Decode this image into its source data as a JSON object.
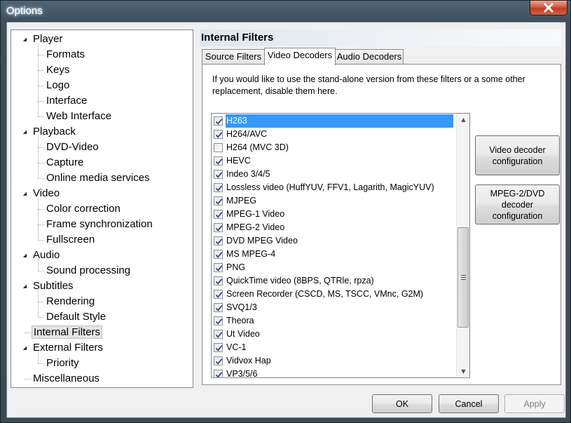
{
  "window": {
    "title": "Options",
    "close_glyph": "close-icon"
  },
  "tree": {
    "groups": [
      {
        "label": "Player",
        "expanded": true,
        "children": [
          "Formats",
          "Keys",
          "Logo",
          "Interface",
          "Web Interface"
        ]
      },
      {
        "label": "Playback",
        "expanded": true,
        "children": [
          "DVD-Video",
          "Capture",
          "Online media services"
        ]
      },
      {
        "label": "Video",
        "expanded": true,
        "children": [
          "Color correction",
          "Frame synchronization",
          "Fullscreen"
        ]
      },
      {
        "label": "Audio",
        "expanded": true,
        "children": [
          "Sound processing"
        ]
      },
      {
        "label": "Subtitles",
        "expanded": true,
        "children": [
          "Rendering",
          "Default Style"
        ]
      },
      {
        "label": "Internal Filters",
        "expanded": false,
        "selected": true,
        "children": []
      },
      {
        "label": "External Filters",
        "expanded": true,
        "children": [
          "Priority"
        ]
      },
      {
        "label": "Miscellaneous",
        "expanded": false,
        "children": []
      }
    ]
  },
  "panel": {
    "title": "Internal Filters",
    "tabs": [
      {
        "label": "Source Filters",
        "active": false
      },
      {
        "label": "Video Decoders",
        "active": true
      },
      {
        "label": "Audio Decoders",
        "active": false
      }
    ],
    "description": "If you would like to use the stand-alone version from these filters or a some other replacement, disable them here.",
    "decoders": [
      {
        "label": "H263",
        "checked": true,
        "selected": true
      },
      {
        "label": "H264/AVC",
        "checked": true
      },
      {
        "label": "H264 (MVC 3D)",
        "checked": false
      },
      {
        "label": "HEVC",
        "checked": true
      },
      {
        "label": "Indeo 3/4/5",
        "checked": true
      },
      {
        "label": "Lossless video (HuffYUV, FFV1, Lagarith, MagicYUV)",
        "checked": true
      },
      {
        "label": "MJPEG",
        "checked": true
      },
      {
        "label": "MPEG-1 Video",
        "checked": true
      },
      {
        "label": "MPEG-2 Video",
        "checked": true
      },
      {
        "label": "DVD MPEG Video",
        "checked": true
      },
      {
        "label": "MS MPEG-4",
        "checked": true
      },
      {
        "label": "PNG",
        "checked": true
      },
      {
        "label": "QuickTime video (8BPS, QTRle, rpza)",
        "checked": true
      },
      {
        "label": "Screen Recorder (CSCD, MS, TSCC, VMnc, G2M)",
        "checked": true
      },
      {
        "label": "SVQ1/3",
        "checked": true
      },
      {
        "label": "Theora",
        "checked": true
      },
      {
        "label": "Ut Video",
        "checked": true
      },
      {
        "label": "VC-1",
        "checked": true
      },
      {
        "label": "Vidvox Hap",
        "checked": true
      },
      {
        "label": "VP3/5/6",
        "checked": true
      }
    ],
    "side_buttons": {
      "video_decoder_config": "Video decoder configuration",
      "mpeg2_dvd_config": "MPEG-2/DVD decoder configuration"
    }
  },
  "footer": {
    "ok": "OK",
    "cancel": "Cancel",
    "apply": "Apply",
    "apply_enabled": false
  },
  "colors": {
    "selection": "#3399ff",
    "frame": "#3d4f5d",
    "close": "#c23a1c"
  }
}
